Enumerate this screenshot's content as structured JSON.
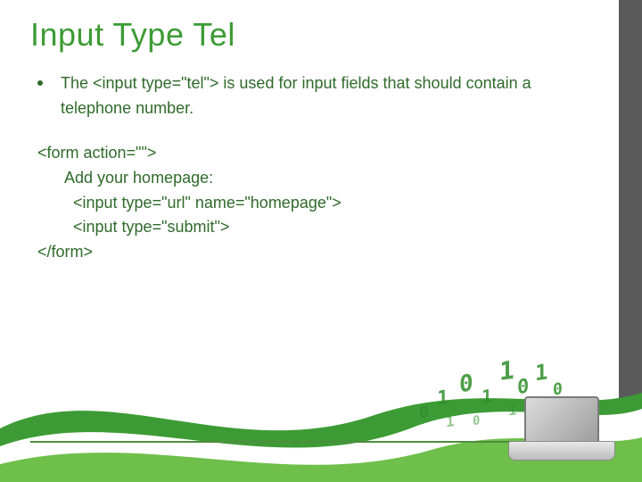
{
  "title": "Input Type Tel",
  "bullet": {
    "pre": "The ",
    "code": "<input type=\"tel\">",
    "post": " is used for input fields that should contain a telephone number."
  },
  "code": {
    "l1": "<form action=\"\">",
    "l2": "Add your homepage:",
    "l3": "<input type=\"url\" name=\"homepage\">",
    "l4": "<input type=\"submit\">",
    "l5": "</form>"
  }
}
